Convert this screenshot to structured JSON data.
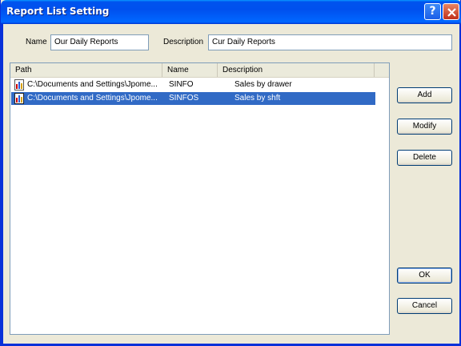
{
  "window": {
    "title": "Report List Setting"
  },
  "title_buttons": {
    "help": "?",
    "close": "X"
  },
  "form": {
    "name_label": "Name",
    "name_value": "Our Daily Reports",
    "description_label": "Description",
    "description_value": "Cur Daily Reports"
  },
  "list": {
    "columns": [
      "Path",
      "Name",
      "Description"
    ],
    "rows": [
      {
        "path": "C:\\Documents and Settings\\Jpome...",
        "name": "SINFO",
        "description": "Sales by drawer",
        "selected": false
      },
      {
        "path": "C:\\Documents and Settings\\Jpome...",
        "name": "SINFOS",
        "description": "Sales by shft",
        "selected": true
      }
    ]
  },
  "buttons": {
    "add": "Add",
    "modify": "Modify",
    "delete": "Delete",
    "ok": "OK",
    "cancel": "Cancel"
  },
  "colors": {
    "titlebar": "#0053ee",
    "selection": "#316ac5",
    "dialog": "#ece9d8"
  }
}
